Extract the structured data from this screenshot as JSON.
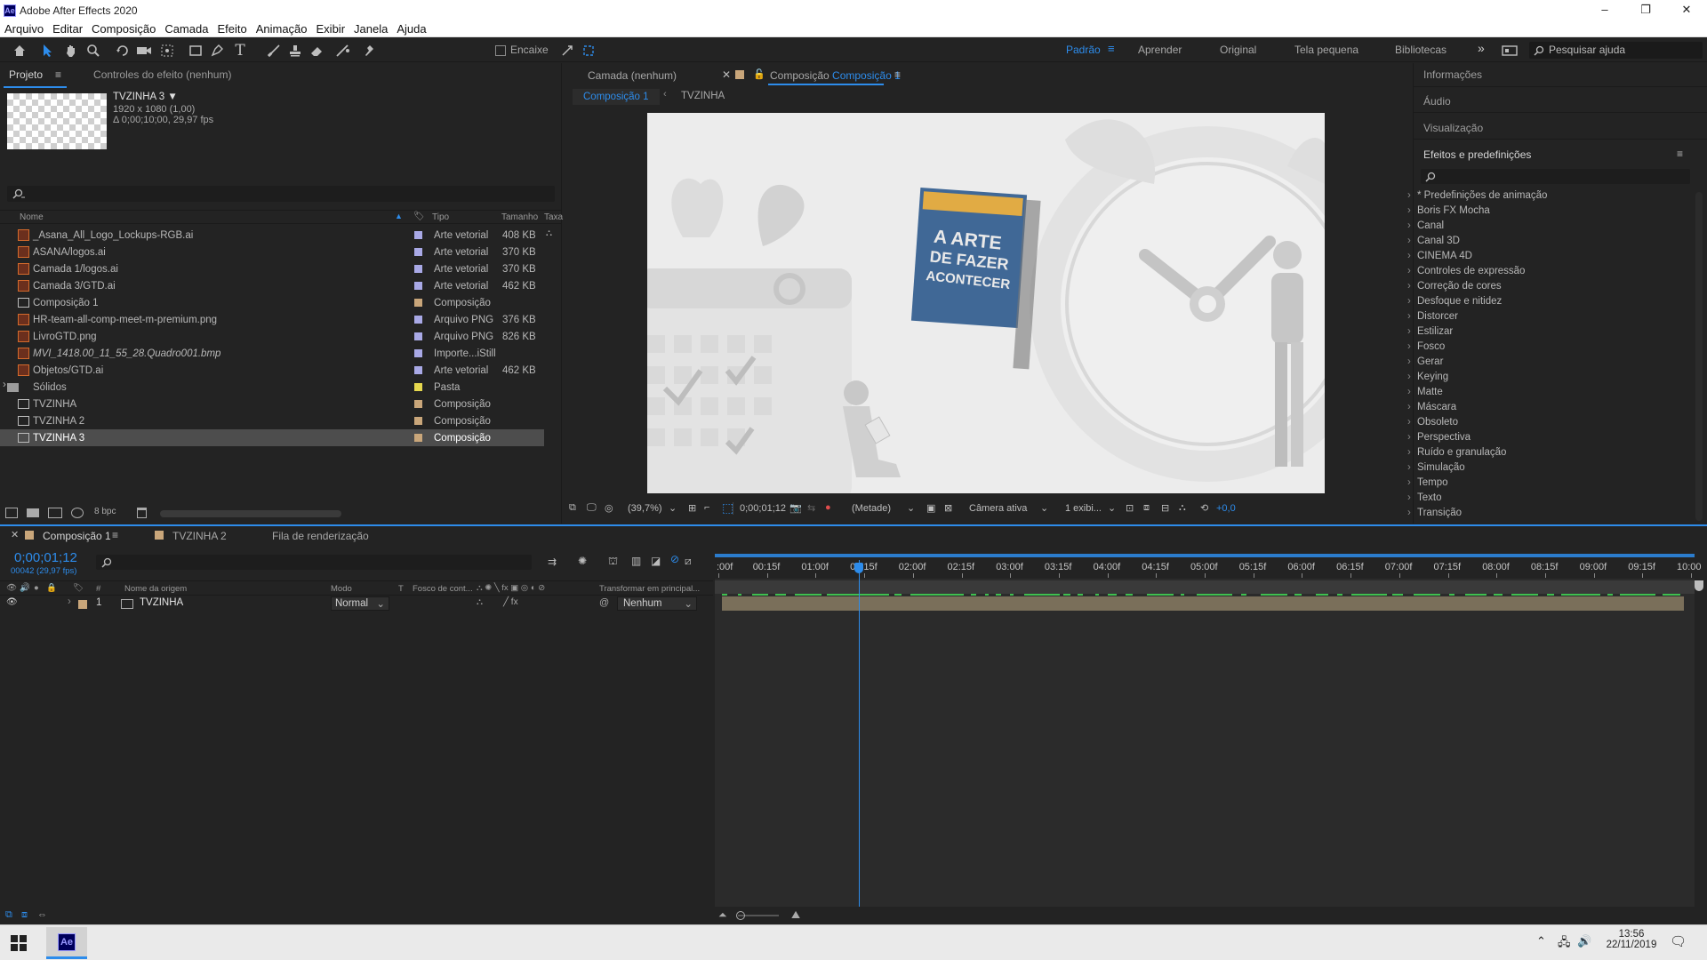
{
  "window": {
    "title": "Adobe After Effects 2020",
    "app_icon": "Ae",
    "controls": [
      "–",
      "❐",
      "✕"
    ]
  },
  "menu": [
    "Arquivo",
    "Editar",
    "Composição",
    "Camada",
    "Efeito",
    "Animação",
    "Exibir",
    "Janela",
    "Ajuda"
  ],
  "toolbar": {
    "snap_label": "Encaixe",
    "workspaces": [
      "Padrão",
      "Aprender",
      "Original",
      "Tela pequena",
      "Bibliotecas"
    ],
    "active_workspace": "Padrão",
    "search_help_placeholder": "Pesquisar ajuda",
    "accent": "#2d8ceb"
  },
  "project_panel": {
    "tabs": [
      "Projeto",
      "Controles do efeito  (nenhum)"
    ],
    "selected_item": {
      "name": "TVZINHA 3 ▼",
      "resolution": "1920 x 1080 (1,00)",
      "duration": "Δ 0;00;10;00, 29,97 fps"
    },
    "columns": [
      "Nome",
      "Tipo",
      "Tamanho",
      "Taxa"
    ],
    "items": [
      {
        "name": "_Asana_All_Logo_Lockups-RGB.ai",
        "type": "Arte vetorial",
        "size": "408 KB",
        "icon": "ai-file-icon",
        "label_color": "#a9a9e6"
      },
      {
        "name": "ASANA/logos.ai",
        "type": "Arte vetorial",
        "size": "370 KB",
        "icon": "ai-file-icon",
        "label_color": "#a9a9e6"
      },
      {
        "name": "Camada 1/logos.ai",
        "type": "Arte vetorial",
        "size": "370 KB",
        "icon": "ai-file-icon",
        "label_color": "#a9a9e6"
      },
      {
        "name": "Camada 3/GTD.ai",
        "type": "Arte vetorial",
        "size": "462 KB",
        "icon": "ai-file-icon",
        "label_color": "#a9a9e6"
      },
      {
        "name": "Composição 1",
        "type": "Composição",
        "size": "",
        "icon": "composition-icon",
        "label_color": "#c9a67a"
      },
      {
        "name": "HR-team-all-comp-meet-m-premium.png",
        "type": "Arquivo PNG",
        "size": "376 KB",
        "icon": "png-file-icon",
        "label_color": "#a9a9e6"
      },
      {
        "name": "LivroGTD.png",
        "type": "Arquivo PNG",
        "size": "826 KB",
        "icon": "png-file-icon",
        "label_color": "#a9a9e6"
      },
      {
        "name": "MVI_1418.00_11_55_28.Quadro001.bmp",
        "type": "Importe...iStill",
        "size": "",
        "icon": "bmp-file-icon",
        "label_color": "#a9a9e6"
      },
      {
        "name": "Objetos/GTD.ai",
        "type": "Arte vetorial",
        "size": "462 KB",
        "icon": "ai-file-icon",
        "label_color": "#a9a9e6"
      },
      {
        "name": "Sólidos",
        "type": "Pasta",
        "size": "",
        "icon": "folder-icon",
        "label_color": "#e6d84e"
      },
      {
        "name": "TVZINHA",
        "type": "Composição",
        "size": "",
        "icon": "composition-icon",
        "label_color": "#c9a67a"
      },
      {
        "name": "TVZINHA 2",
        "type": "Composição",
        "size": "",
        "icon": "composition-icon",
        "label_color": "#c9a67a"
      },
      {
        "name": "TVZINHA 3",
        "type": "Composição",
        "size": "",
        "icon": "composition-icon",
        "label_color": "#c9a67a",
        "selected": true
      }
    ],
    "bpc": "8 bpc"
  },
  "viewer": {
    "tabs": [
      "Camada  (nenhum)",
      "Composição",
      "Composição 1"
    ],
    "breadcrumbs": [
      "Composição 1",
      "TVZINHA"
    ],
    "book_title_lines": [
      "A ARTE",
      "DE FAZER",
      "ACONTECER"
    ],
    "zoom": "(39,7%)",
    "timecode": "0;00;01;12",
    "resolution": "(Metade)",
    "camera": "Câmera ativa",
    "views": "1 exibi...",
    "exposure": "+0,0"
  },
  "right_panel": {
    "headers": [
      "Informações",
      "Áudio",
      "Visualização",
      "Efeitos e predefinições"
    ],
    "effects": [
      "* Predefinições de animação",
      "Boris FX Mocha",
      "Canal",
      "Canal 3D",
      "CINEMA 4D",
      "Controles de expressão",
      "Correção de cores",
      "Desfoque e nitidez",
      "Distorcer",
      "Estilizar",
      "Fosco",
      "Gerar",
      "Keying",
      "Matte",
      "Máscara",
      "Obsoleto",
      "Perspectiva",
      "Ruído e granulação",
      "Simulação",
      "Tempo",
      "Texto",
      "Transição"
    ]
  },
  "timeline": {
    "tabs": [
      "Composição 1",
      "TVZINHA 2",
      "Fila de renderização"
    ],
    "current_time": "0;00;01;12",
    "current_frame": "00042 (29,97 fps)",
    "columns": [
      "#",
      "Nome da origem",
      "Modo",
      "T",
      "Fosco de cont...",
      "Transformar em principal..."
    ],
    "layer": {
      "index": "1",
      "name": "TVZINHA",
      "mode": "Normal",
      "parent": "Nenhum"
    },
    "ruler": [
      ":00f",
      "00:15f",
      "01:00f",
      "01:15f",
      "02:00f",
      "02:15f",
      "03:00f",
      "03:15f",
      "04:00f",
      "04:15f",
      "05:00f",
      "05:15f",
      "06:00f",
      "06:15f",
      "07:00f",
      "07:15f",
      "08:00f",
      "08:15f",
      "09:00f",
      "09:15f",
      "10:00"
    ],
    "playhead_fraction": 0.144,
    "layer_bar_color": "#7a6f5a",
    "audio_marker_color": "#3fbf4f"
  },
  "taskbar": {
    "time": "13:56",
    "date": "22/11/2019",
    "app": "Ae"
  }
}
